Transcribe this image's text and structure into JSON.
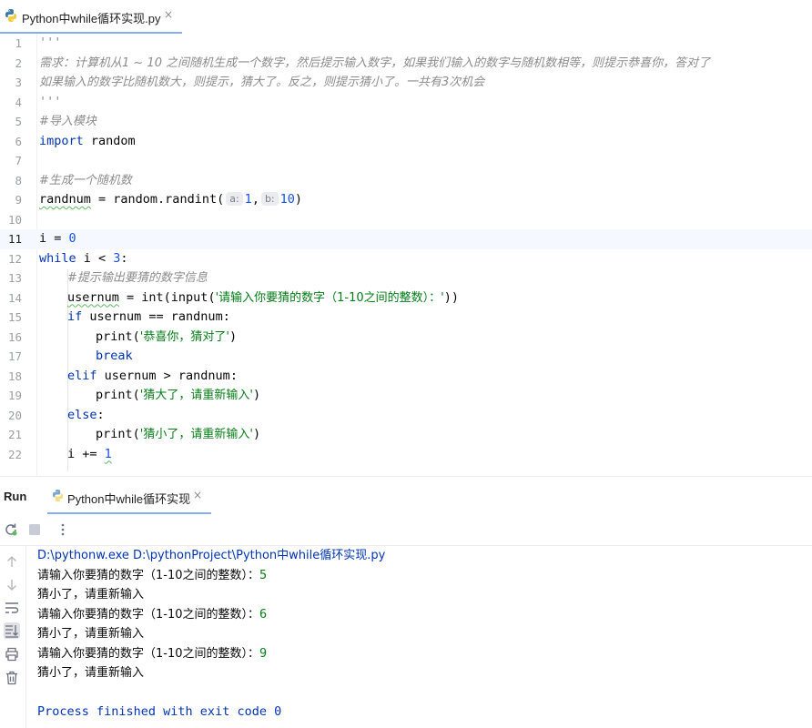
{
  "editor_tab": {
    "filename": "Python中while循环实现.py",
    "close_symbol": "×"
  },
  "code": {
    "line_numbers": [
      "1",
      "2",
      "3",
      "4",
      "5",
      "6",
      "7",
      "8",
      "9",
      "10",
      "11",
      "12",
      "13",
      "14",
      "15",
      "16",
      "17",
      "18",
      "19",
      "20",
      "21",
      "22"
    ],
    "l1": "'''",
    "l2": "需求：计算机从1 ~ 10 之间随机生成一个数字，然后提示输入数字，如果我们输入的数字与随机数相等，则提示恭喜你，答对了",
    "l3": "如果输入的数字比随机数大，则提示，猜大了。反之，则提示猜小了。一共有3次机会",
    "l4": "'''",
    "l5": "#导入模块",
    "l6_kw": "import",
    "l6_rest": " random",
    "l8": "#生成一个随机数",
    "l9_var": "randnum",
    "l9_mid": " = random.randint(",
    "l9_hint_a": "a:",
    "l9_a": "1",
    "l9_comma": ",",
    "l9_hint_b": "b:",
    "l9_b": "10",
    "l9_end": ")",
    "l11_a": "i = ",
    "l11_num": "0",
    "l12_kw": "while",
    "l12_mid": " i < ",
    "l12_num": "3",
    "l12_end": ":",
    "l13": "#提示输出要猜的数字信息",
    "l14_var": "usernum",
    "l14_mid": " = int(input(",
    "l14_str": "'请输入你要猜的数字（1-10之间的整数）：'",
    "l14_end": "))",
    "l15_kw": "if",
    "l15_rest": " usernum == randnum:",
    "l16_fn": "print(",
    "l16_str": "'恭喜你，猜对了'",
    "l16_end": ")",
    "l17_kw": "break",
    "l18_kw": "elif",
    "l18_rest": " usernum > randnum:",
    "l19_fn": "print(",
    "l19_str": "'猜大了，请重新输入'",
    "l19_end": ")",
    "l20_kw": "else",
    "l20_end": ":",
    "l21_fn": "print(",
    "l21_str": "'猜小了，请重新输入'",
    "l21_end": ")",
    "l22_a": "i += ",
    "l22_num": "1"
  },
  "run_panel": {
    "title": "Run",
    "tab_label": "Python中while循环实现",
    "close_symbol": "×",
    "console": {
      "command": "D:\\pythonw.exe D:\\pythonProject\\Python中while循环实现.py",
      "prompt": "请输入你要猜的数字（1-10之间的整数）：",
      "inputs": [
        "5",
        "6",
        "9"
      ],
      "response": "猜小了，请重新输入",
      "exit": "Process finished with exit code 0"
    }
  },
  "icons": {
    "python_file": "python-file-icon",
    "rerun": "rerun-icon",
    "stop": "stop-icon",
    "more": "more-options-icon",
    "up": "arrow-up-icon",
    "down": "arrow-down-icon",
    "soft_wrap": "soft-wrap-icon",
    "scroll_to_end": "scroll-to-end-icon",
    "print": "print-icon",
    "trash": "trash-icon"
  },
  "colors": {
    "keyword": "#0033b3",
    "number": "#1750eb",
    "string": "#067d17",
    "comment": "#8c8c8c",
    "tab_underline": "#3574f0"
  }
}
